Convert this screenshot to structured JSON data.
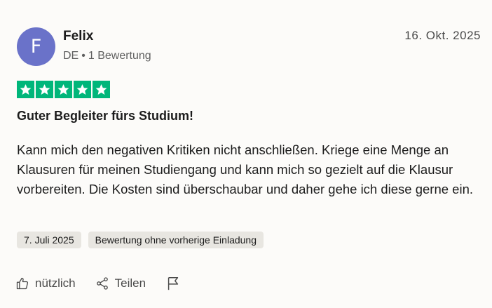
{
  "reviewer": {
    "initial": "F",
    "name": "Felix",
    "country": "DE",
    "separator": "•",
    "review_count": "1 Bewertung",
    "avatar_color": "#6a72c9"
  },
  "review": {
    "date": "16. Okt. 2025",
    "rating": 5,
    "star_color": "#00b67a",
    "title": "Guter Begleiter fürs Studium!",
    "text": "Kann mich den negativen Kritiken nicht anschließen. Kriege eine Menge an Klausuren für meinen Studiengang und kann mich so gezielt auf die Klausur vorbereiten. Die Kosten sind überschaubar und daher gehe ich diese gerne ein.",
    "experience_date": "7. Juli 2025",
    "invitation_tag": "Bewertung ohne vorherige Einladung"
  },
  "actions": {
    "useful_label": "nützlich",
    "share_label": "Teilen",
    "useful_icon": "thumbs-up-icon",
    "share_icon": "share-icon",
    "report_icon": "flag-icon"
  }
}
